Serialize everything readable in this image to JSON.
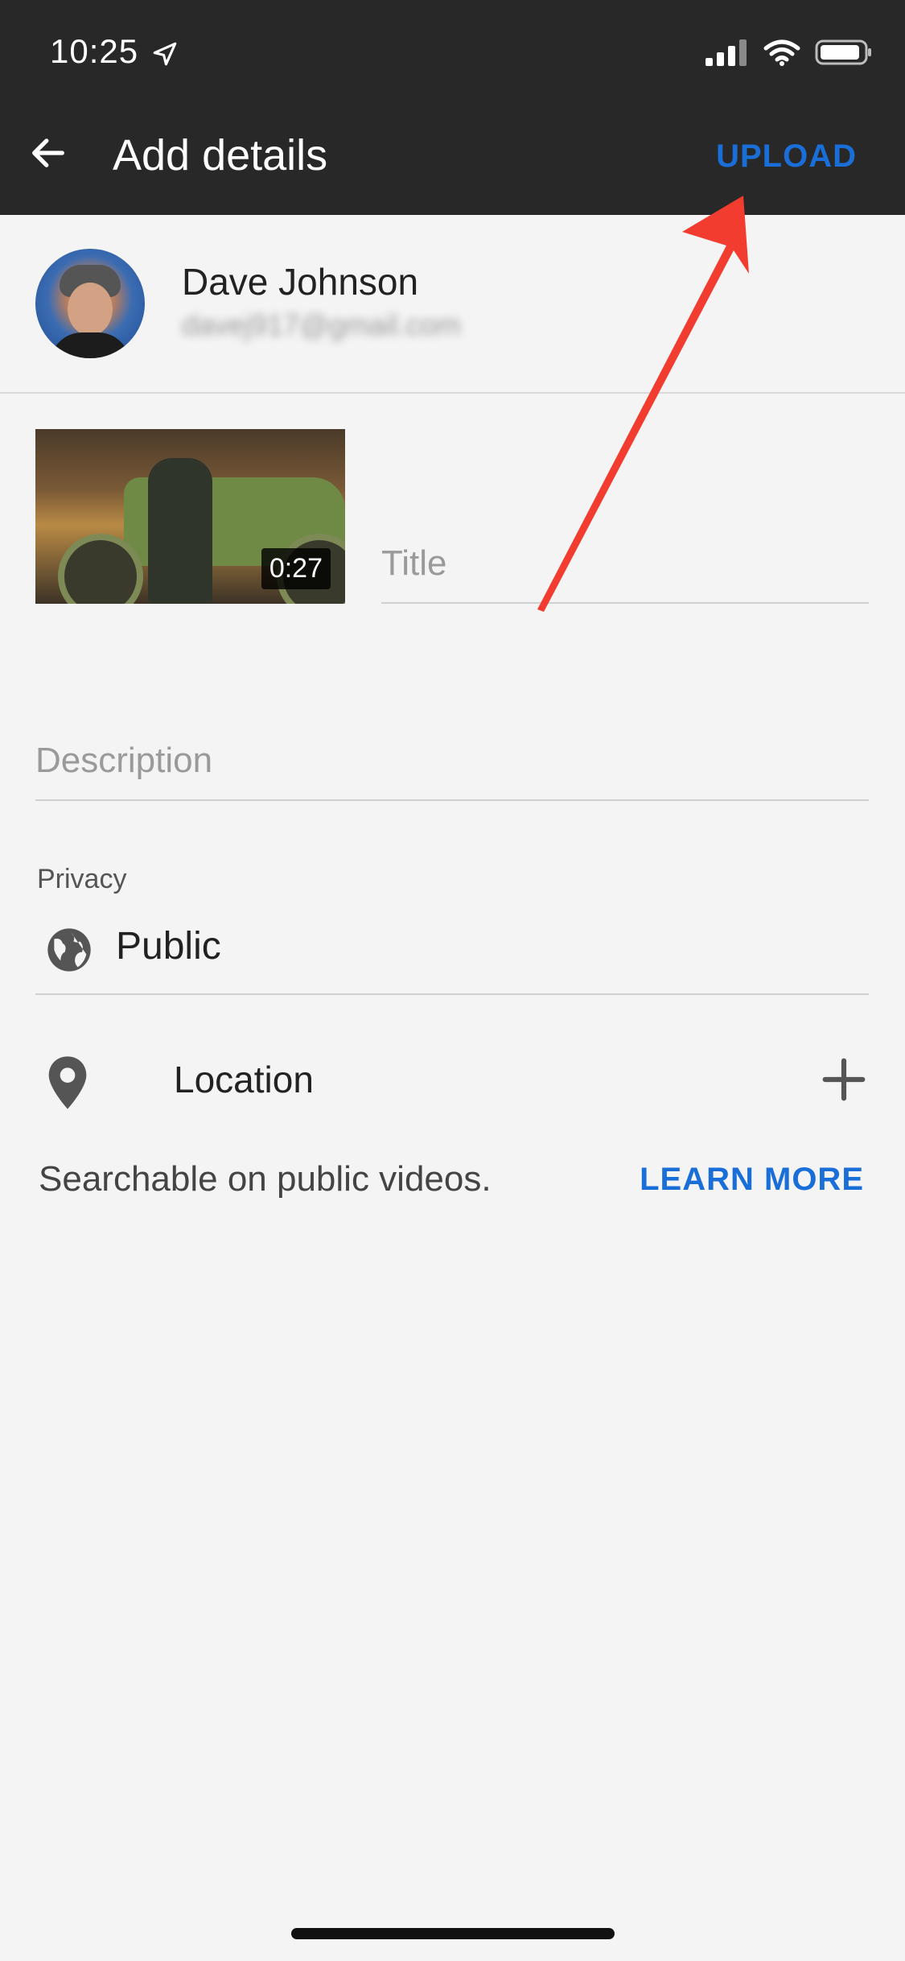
{
  "status_bar": {
    "time": "10:25",
    "icons": [
      "location-arrow-icon",
      "cellular-signal-icon",
      "wifi-icon",
      "battery-icon"
    ]
  },
  "header": {
    "title": "Add details",
    "upload_label": "UPLOAD",
    "back_icon": "back-arrow-icon"
  },
  "account": {
    "name": "Dave Johnson",
    "email": "davej917@gmail.com"
  },
  "video": {
    "duration": "0:27"
  },
  "form": {
    "title_placeholder": "Title",
    "title_value": "",
    "description_placeholder": "Description",
    "description_value": ""
  },
  "privacy": {
    "label": "Privacy",
    "value": "Public",
    "icon": "globe-icon"
  },
  "location": {
    "label": "Location",
    "icon": "location-pin-icon",
    "add_icon": "plus-icon"
  },
  "note": {
    "text": "Searchable on public videos.",
    "link_label": "LEARN MORE"
  },
  "colors": {
    "header_bg": "#282828",
    "accent": "#1a6ed8",
    "page_bg": "#f4f4f4",
    "annotation_arrow": "#f23c2f"
  }
}
